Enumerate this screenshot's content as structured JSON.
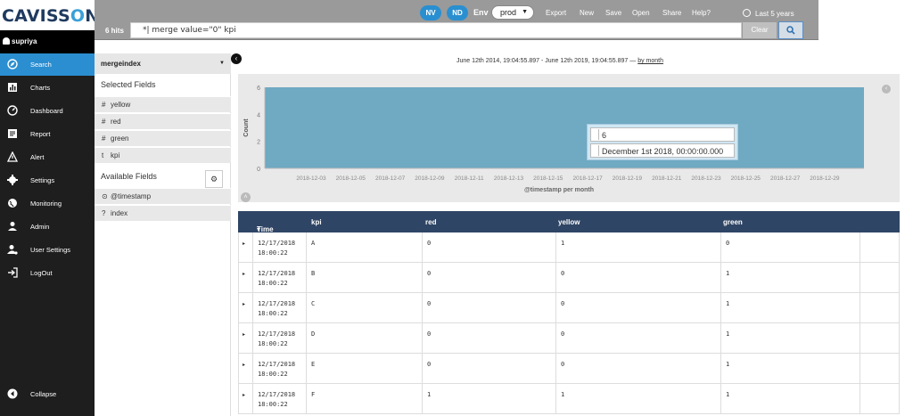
{
  "app": {
    "logo": "CAVISSON"
  },
  "topbar": {
    "nv": "NV",
    "nd": "ND",
    "env_label": "Env",
    "env_value": "prod",
    "menu": [
      "Export",
      "New",
      "Save",
      "Open",
      "Share",
      "Help?"
    ],
    "time_range": "Last 5 years",
    "hits": "6 hits",
    "query": "*| merge value=\"0\" kpi",
    "clear_label": "Clear"
  },
  "user": {
    "name": "supriya"
  },
  "nav": {
    "items": [
      {
        "label": "Search",
        "icon": "compass-icon",
        "active": true
      },
      {
        "label": "Charts",
        "icon": "bar-chart-icon"
      },
      {
        "label": "Dashboard",
        "icon": "dashboard-icon"
      },
      {
        "label": "Report",
        "icon": "report-icon"
      },
      {
        "label": "Alert",
        "icon": "alert-icon"
      },
      {
        "label": "Settings",
        "icon": "gear-icon"
      },
      {
        "label": "Monitoring",
        "icon": "globe-icon"
      },
      {
        "label": "Admin",
        "icon": "user-icon"
      },
      {
        "label": "User Settings",
        "icon": "user-settings-icon"
      },
      {
        "label": "LogOut",
        "icon": "logout-icon"
      }
    ],
    "collapse_label": "Collapse"
  },
  "fields": {
    "index": "mergeindex",
    "selected_title": "Selected Fields",
    "selected": [
      {
        "type": "#",
        "name": "yellow"
      },
      {
        "type": "#",
        "name": "red"
      },
      {
        "type": "#",
        "name": "green"
      },
      {
        "type": "t",
        "name": "kpi"
      }
    ],
    "available_title": "Available Fields",
    "available": [
      {
        "type": "⊙",
        "name": "@timestamp"
      },
      {
        "type": "?",
        "name": "index"
      }
    ]
  },
  "range": {
    "text": "June 12th 2014, 19:04:55.897 - June 12th 2019, 19:04:55.897 —",
    "link": "by month"
  },
  "chart_data": {
    "type": "bar",
    "ylabel": "Count",
    "xlabel": "@timestamp per month",
    "ylim": [
      0,
      6
    ],
    "yticks": [
      0,
      2,
      4,
      6
    ],
    "categories": [
      "2018-12-03",
      "2018-12-05",
      "2018-12-07",
      "2018-12-09",
      "2018-12-11",
      "2018-12-13",
      "2018-12-15",
      "2018-12-17",
      "2018-12-19",
      "2018-12-21",
      "2018-12-23",
      "2018-12-25",
      "2018-12-27",
      "2018-12-29"
    ],
    "bars": [
      {
        "x": "December 1st 2018, 00:00:00.000",
        "value": 6
      }
    ],
    "tooltip": {
      "value": "6",
      "label": "December 1st 2018, 00:00:00.000"
    },
    "colors": {
      "bar": "#6fa9c2"
    }
  },
  "table": {
    "columns": [
      "Time",
      "kpi",
      "red",
      "yellow",
      "green"
    ],
    "rows": [
      {
        "date": "12/17/2018",
        "time": "18:00:22",
        "kpi": "A",
        "red": "0",
        "yellow": "1",
        "green": "0"
      },
      {
        "date": "12/17/2018",
        "time": "18:00:22",
        "kpi": "B",
        "red": "0",
        "yellow": "0",
        "green": "1"
      },
      {
        "date": "12/17/2018",
        "time": "18:00:22",
        "kpi": "C",
        "red": "0",
        "yellow": "0",
        "green": "1"
      },
      {
        "date": "12/17/2018",
        "time": "18:00:22",
        "kpi": "D",
        "red": "0",
        "yellow": "0",
        "green": "1"
      },
      {
        "date": "12/17/2018",
        "time": "18:00:22",
        "kpi": "E",
        "red": "0",
        "yellow": "0",
        "green": "1"
      },
      {
        "date": "12/17/2018",
        "time": "18:00:22",
        "kpi": "F",
        "red": "1",
        "yellow": "1",
        "green": "1"
      }
    ]
  },
  "colors": {
    "accent": "#2b8ed1",
    "header": "#2f4565",
    "nav_bg": "#1e1e1e"
  }
}
